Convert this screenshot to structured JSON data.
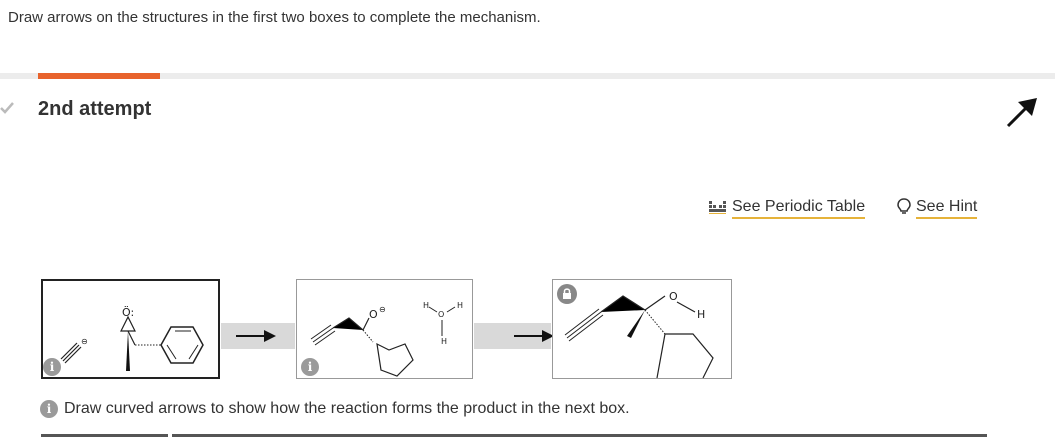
{
  "instruction": "Draw arrows on the structures in the first two boxes to complete the mechanism.",
  "attempt": {
    "title": "2nd attempt"
  },
  "tools": {
    "periodic_table": "See Periodic Table",
    "hint": "See Hint"
  },
  "colors": {
    "accent_tab": "#e8632c",
    "link_underline": "#e6b33a"
  },
  "footer": {
    "text": "Draw curved arrows to show how the reaction forms the product in the next box."
  },
  "mechanism": {
    "box1": {
      "atoms": {
        "oxygen": "Ö:",
        "charge": "⊖"
      }
    },
    "box2": {
      "atoms": {
        "oxygen": "O",
        "h1": "H",
        "h2": "H",
        "h3": "H",
        "o_center": "O"
      }
    },
    "box3": {
      "atoms": {
        "oxygen": "O",
        "h": "H"
      }
    }
  },
  "icons": [
    "check-icon",
    "flag-icon",
    "periodic-table-icon",
    "lightbulb-icon",
    "info-icon",
    "lock-icon",
    "arrow-right-icon"
  ]
}
